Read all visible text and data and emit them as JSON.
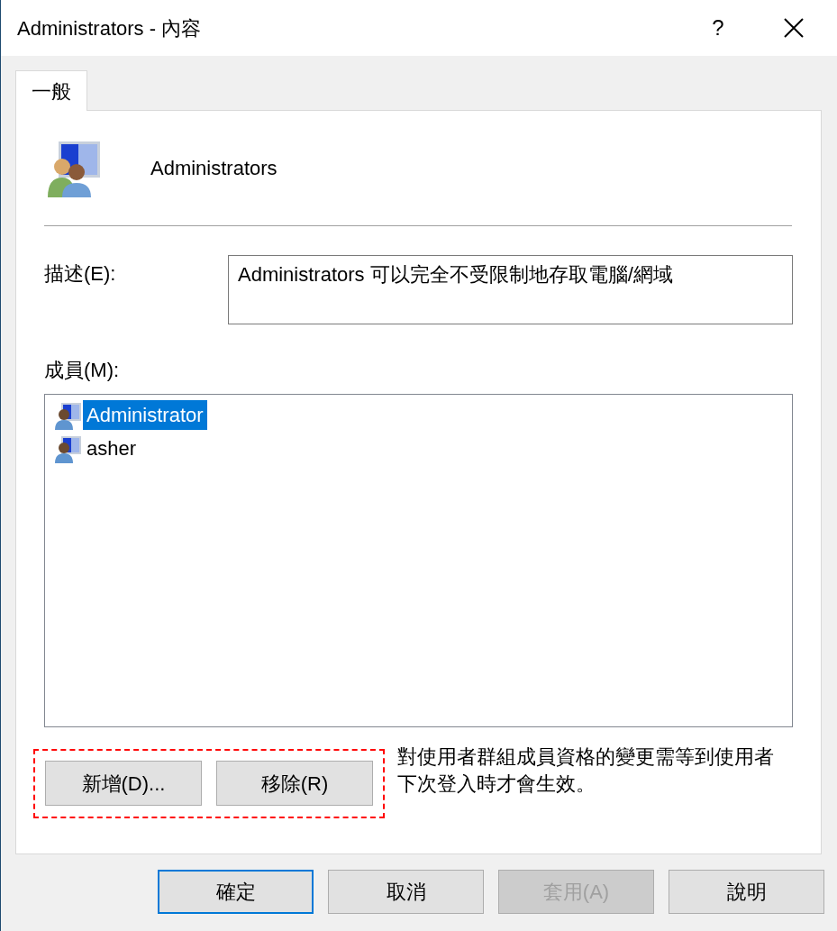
{
  "window": {
    "title": "Administrators - 內容",
    "help": "?"
  },
  "tabs": [
    {
      "label": "一般",
      "selected": true
    }
  ],
  "group": {
    "name": "Administrators"
  },
  "description": {
    "label": "描述(E):",
    "value": "Administrators 可以完全不受限制地存取電腦/網域"
  },
  "members": {
    "label": "成員(M):",
    "items": [
      {
        "name": "Administrator",
        "selected": true
      },
      {
        "name": "asher",
        "selected": false
      }
    ]
  },
  "member_buttons": [
    {
      "label": "新增(D)..."
    },
    {
      "label": "移除(R)"
    }
  ],
  "note": "對使用者群組成員資格的變更需等到使用者下次登入時才會生效。",
  "buttons": [
    {
      "label": "確定",
      "default": true,
      "disabled": false
    },
    {
      "label": "取消",
      "default": false,
      "disabled": false
    },
    {
      "label": "套用(A)",
      "default": false,
      "disabled": true
    },
    {
      "label": "說明",
      "default": false,
      "disabled": false
    }
  ]
}
